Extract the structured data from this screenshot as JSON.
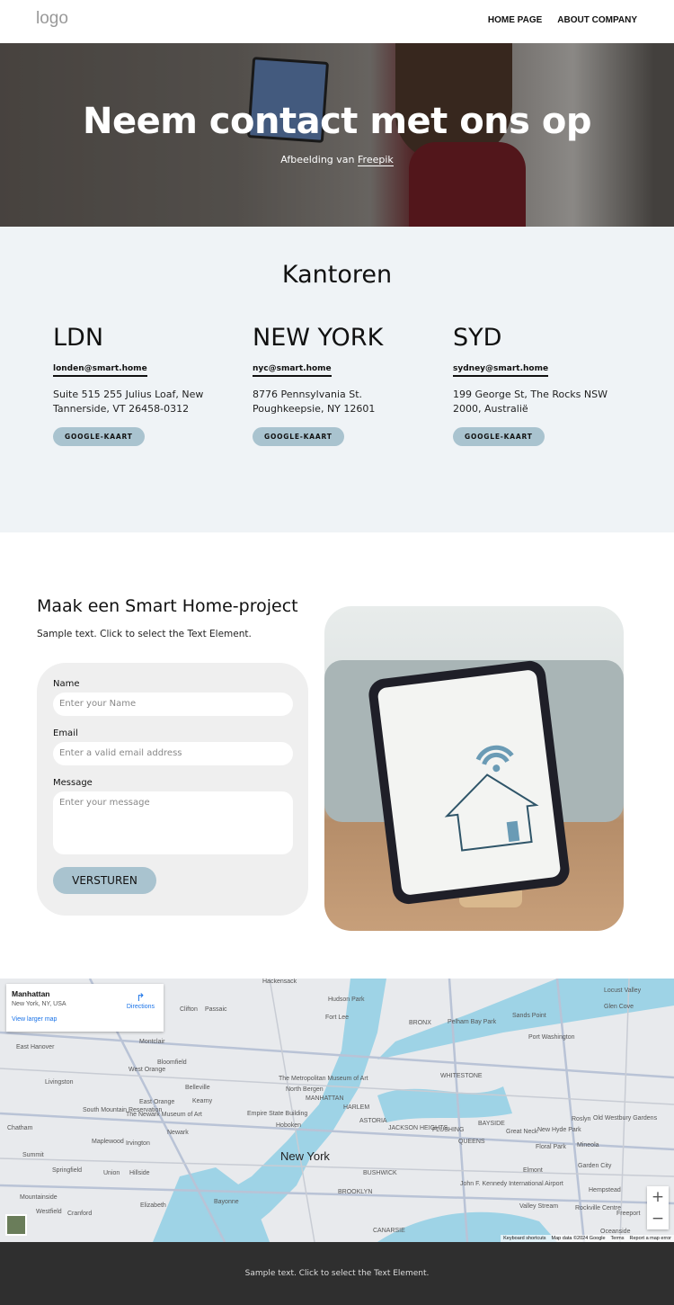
{
  "header": {
    "logo": "logo",
    "nav": [
      "HOME PAGE",
      "ABOUT COMPANY"
    ]
  },
  "hero": {
    "title": "Neem contact met ons op",
    "credit_prefix": "Afbeelding van ",
    "credit_link": "Freepik"
  },
  "offices": {
    "title": "Kantoren",
    "items": [
      {
        "city": "LDN",
        "email": "londen@smart.home",
        "address": "Suite 515 255 Julius Loaf, New Tannerside, VT 26458-0312",
        "button": "GOOGLE-KAART"
      },
      {
        "city": "NEW YORK",
        "email": "nyc@smart.home",
        "address": "8776 Pennsylvania St. Poughkeepsie, NY 12601",
        "button": "GOOGLE-KAART"
      },
      {
        "city": "SYD",
        "email": "sydney@smart.home",
        "address": "199 George St, The Rocks NSW 2000, Australië",
        "button": "GOOGLE-KAART"
      }
    ]
  },
  "project": {
    "title": "Maak een Smart Home-project",
    "text": "Sample text. Click to select the Text Element.",
    "form": {
      "name_label": "Name",
      "name_placeholder": "Enter your Name",
      "email_label": "Email",
      "email_placeholder": "Enter a valid email address",
      "message_label": "Message",
      "message_placeholder": "Enter your message",
      "submit": "VERSTUREN"
    }
  },
  "map": {
    "place": "Manhattan",
    "place_sub": "New York, NY, USA",
    "directions": "Directions",
    "larger": "View larger map",
    "zoom_in": "+",
    "zoom_out": "−",
    "attribution": [
      "Keyboard shortcuts",
      "Map data ©2024 Google",
      "Terms",
      "Report a map error"
    ],
    "labels": [
      "Hackensack",
      "Hudson Park",
      "Fort Lee",
      "Pelham Bay Park",
      "Glen Cove",
      "Sands Point",
      "Port Washington",
      "Clifton",
      "Passaic",
      "Montclair",
      "Bloomfield",
      "East Hanover",
      "West Orange",
      "Livingston",
      "Belleville",
      "North Bergen",
      "HARLEM",
      "BRONX",
      "The Metropolitan Museum of Art",
      "MANHATTAN",
      "Kearny",
      "East Orange",
      "Newark",
      "Empire State Building",
      "Hoboken",
      "South Mountain Reservation",
      "The Newark Museum of Art",
      "Maplewood",
      "Irvington",
      "Chatham",
      "Summit",
      "Springfield",
      "Union",
      "Hillside",
      "New York",
      "Elizabeth",
      "Bayonne",
      "BROOKLYN",
      "QUEENS",
      "Great Neck",
      "Roslyn",
      "Old Westbury Gardens",
      "Mineola",
      "Garden City",
      "Hempstead",
      "Elmont",
      "John F. Kennedy International Airport",
      "Valley Stream",
      "Rockville Centre",
      "Freeport",
      "Oceanside",
      "Westfield",
      "Cranford",
      "Mountainside",
      "New Hyde Park",
      "Floral Park",
      "ASTORIA",
      "FLUSHING",
      "BAYSIDE",
      "JACKSON HEIGHTS",
      "BUSHWICK",
      "CANARSIE",
      "WHITESTONE",
      "Locust Valley"
    ]
  },
  "footer": {
    "text": "Sample text. Click to select the Text Element."
  }
}
